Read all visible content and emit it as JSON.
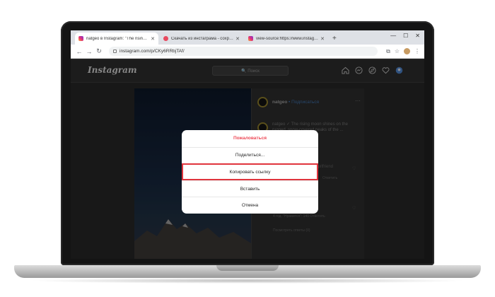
{
  "browser": {
    "tabs": [
      {
        "label": "natgeo в Instagram: \"The rising …",
        "favicon": "instagram-favicon",
        "active": true
      },
      {
        "label": "Скачать из инстаграма - сохра…",
        "favicon": "save-favicon",
        "active": false
      },
      {
        "label": "view-source:https://www.instag…",
        "favicon": "instagram-favicon",
        "active": false
      }
    ],
    "new_tab_glyph": "+",
    "url": "instagram.com/p/CKy6RRbjTAf/"
  },
  "instagram": {
    "logo": "Instagram",
    "search_placeholder": "🔍 Поиск"
  },
  "post": {
    "username": "natgeo",
    "follow_label": "• Подписаться",
    "caption": "natgeo ✓ The rising moon shines on the rugged, snow-covered peaks of the ... range in California ... by",
    "comment_snippet": "girlfriend",
    "reply_label": "Ответить",
    "comment_meta": "4 год. \"Нравится\": 140  Ответить",
    "view_replies": "Посмотреть ответы (0)"
  },
  "modal": {
    "items": [
      {
        "label": "Пожаловаться",
        "style": "danger"
      },
      {
        "label": "Поделиться...",
        "style": "normal"
      },
      {
        "label": "Копировать ссылку",
        "style": "highlighted"
      },
      {
        "label": "Вставить",
        "style": "normal"
      },
      {
        "label": "Отмена",
        "style": "normal"
      }
    ]
  },
  "colors": {
    "danger": "#ed4956",
    "highlight_border": "#e0343d",
    "follow_link": "#3d6ea8"
  }
}
